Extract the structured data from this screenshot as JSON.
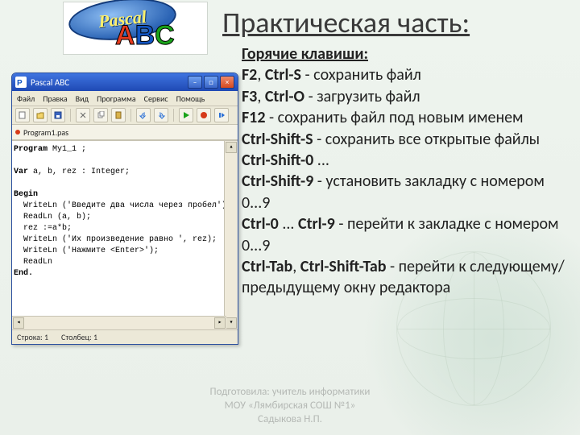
{
  "logo": {
    "word": "Pascal",
    "a": "A",
    "b": "B",
    "c": "C"
  },
  "title": "Практическая часть:",
  "hotkeys_header": "Горячие клавиши:",
  "hk": {
    "l1a": "F2",
    "l1b": "Ctrl-S",
    "l1t": " - сохранить файл",
    "l2a": "F3",
    "l2b": "Ctrl-O",
    "l2t": " - загрузить файл",
    "l3a": "F12",
    "l3t": " - сохранить файл под новым именем",
    "l4a": "Ctrl-Shift-S",
    "l4t": " - сохранить все открытые файлы ",
    "l4b": "Ctrl-Shift-0",
    "l4c": " ... ",
    "l5a": "Ctrl-Shift-9",
    "l5t": " - установить закладку с номером 0...9",
    "l6a": "Ctrl-0",
    "l6m": " ... ",
    "l6b": "Ctrl-9",
    "l6t": " - перейти к закладке с номером 0...9",
    "l7a": "Ctrl-Tab",
    "l7s": ", ",
    "l7b": "Ctrl-Shift-Tab",
    "l7t": " - перейти к следующему/предыдущему окну редактора"
  },
  "app": {
    "title": "Pascal ABC",
    "menu": [
      "Файл",
      "Правка",
      "Вид",
      "Программа",
      "Сервис",
      "Помощь"
    ],
    "tab": "Program1.pas",
    "status_row": "Строка: 1",
    "status_col": "Столбец: 1",
    "code": {
      "c1a": "Program",
      "c1b": " My1_1 ;",
      "c3a": "Var",
      "c3b": " a, b, rez : Integer;",
      "c5": "Begin",
      "c6": "  WriteLn ('Введите два числа через пробел');",
      "c7": "  ReadLn (a, b);",
      "c8": "  rez :=a*b;",
      "c9": "  WriteLn ('Их произведение равно ', rez);",
      "c10": "  WriteLn ('Нажмите <Enter>');",
      "c11": "  ReadLn",
      "c12": "End."
    }
  },
  "credit": {
    "l1": "Подготовила: учитель информатики",
    "l2": "МОУ «Лямбирская СОШ №1»",
    "l3": "Садыкова Н.П."
  }
}
